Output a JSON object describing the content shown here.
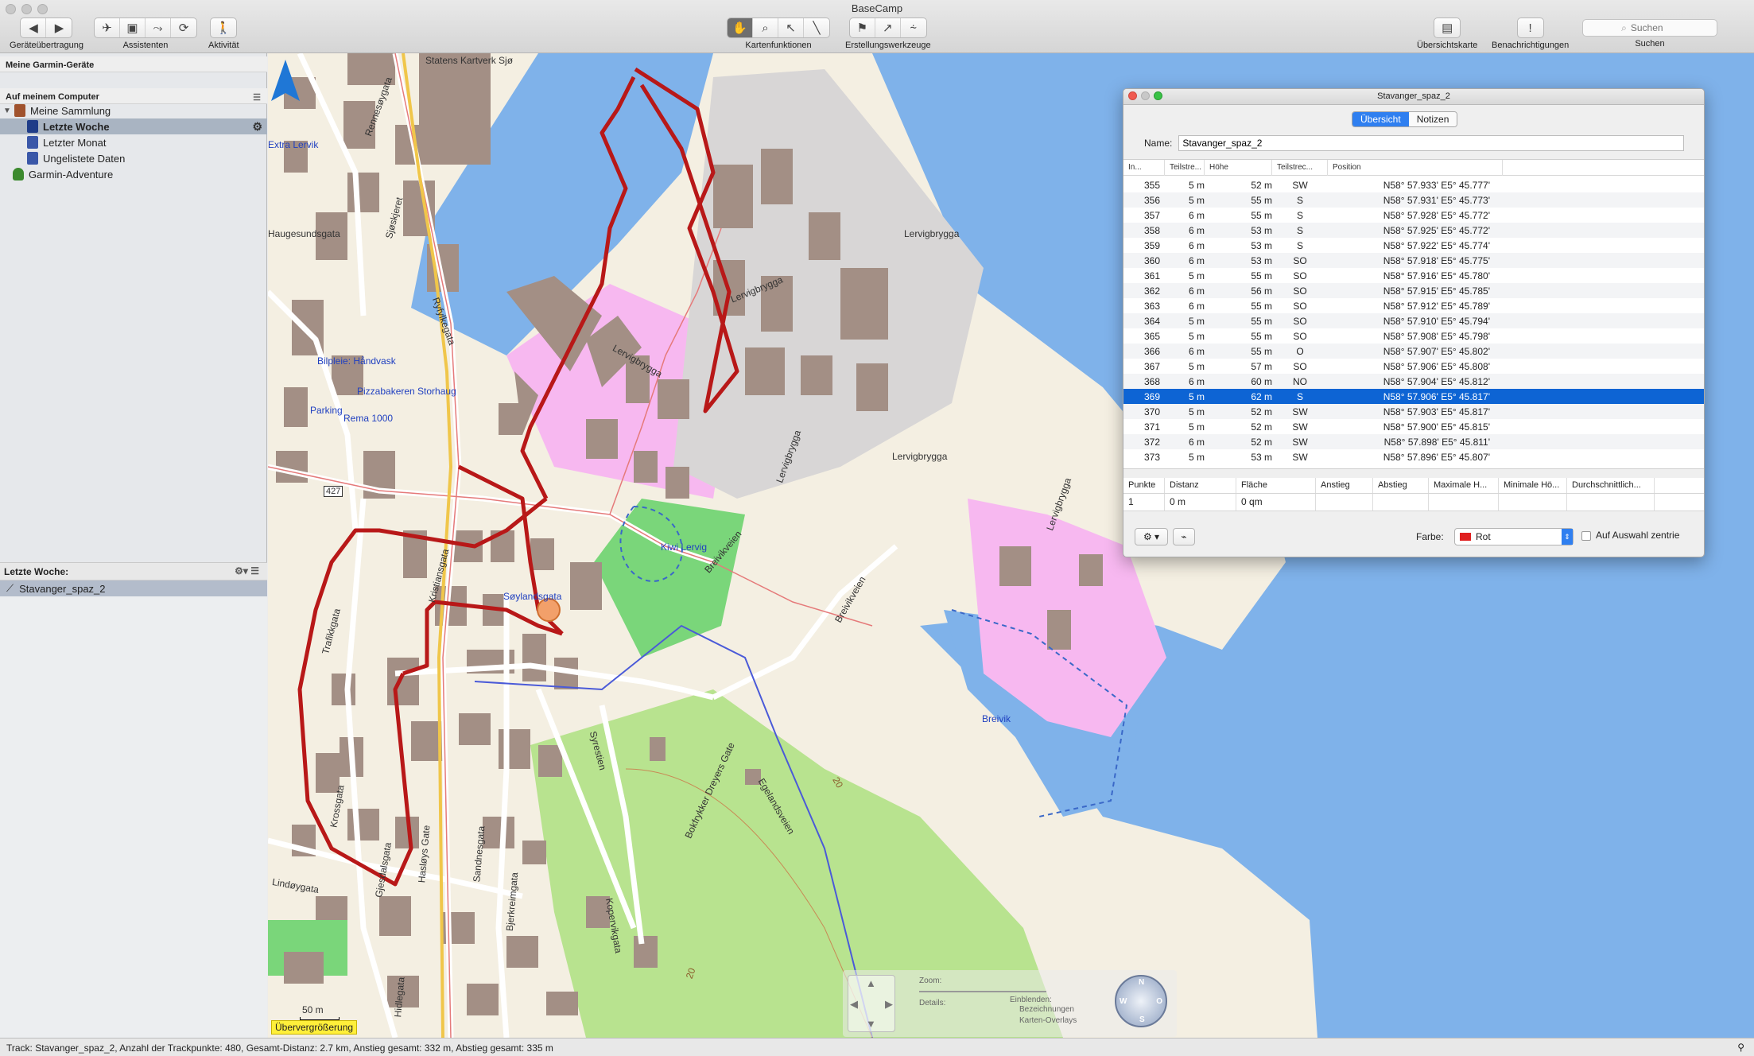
{
  "window": {
    "title": "BaseCamp"
  },
  "toolbar": {
    "groups": [
      {
        "label": "Geräteübertragung"
      },
      {
        "label": "Assistenten"
      },
      {
        "label": "Aktivität"
      },
      {
        "label": "Kartenfunktionen"
      },
      {
        "label": "Erstellungswerkzeuge"
      },
      {
        "label": "Übersichtskarte"
      },
      {
        "label": "Benachrichtigungen"
      },
      {
        "label": "Suchen"
      }
    ],
    "search_placeholder": "Suchen"
  },
  "sidebar": {
    "devices_header": "Meine Garmin-Geräte",
    "computer_header": "Auf meinem Computer",
    "items": [
      {
        "label": "Meine Sammlung"
      },
      {
        "label": "Letzte Woche"
      },
      {
        "label": "Letzter Monat"
      },
      {
        "label": "Ungelistete Daten"
      },
      {
        "label": "Garmin-Adventure"
      }
    ],
    "lower_header": "Letzte Woche:",
    "lower_items": [
      {
        "label": "Stavanger_spaz_2"
      }
    ]
  },
  "map": {
    "labels": [
      "Statens Kartverk Sjø",
      "Haugesundsgata",
      "Extra Lervik",
      "Bilpleie: Håndvask",
      "Pizzabakeren Storhaug",
      "Parking",
      "Rema 1000",
      "427",
      "Kiwi Lervig",
      "Søylandsgata",
      "Lervigbrygga",
      "Lervigbrygga",
      "Lervigbrygga",
      "Lervigbrygga",
      "Lervigbrygga",
      "Lervigbrygga",
      "Breivikveien",
      "Breivikveien",
      "Breivik",
      "Egelandsveien",
      "Bokfrykker Dreyers Gate",
      "Syrestien",
      "Sandnesgata",
      "Hasløys Gate",
      "Kopervikgata",
      "Gjesdalsgata",
      "Krossgata",
      "Lindøygata",
      "Trafikkgata",
      "Ryfylkegata",
      "Sjøskjeret",
      "Rennesøygata",
      "Hidlegata",
      "Kristiansgata",
      "Bjerkreimgata",
      "20",
      "20",
      "50 m"
    ],
    "overzoom_label": "Übervergrößerung",
    "controls": {
      "zoom_label": "Zoom:",
      "details_label": "Details:",
      "show_label": "Einblenden:",
      "check1": "Bezeichnungen",
      "check2": "Karten-Overlays",
      "compass": {
        "n": "N",
        "s": "S",
        "w": "W",
        "o": "O"
      }
    }
  },
  "panel": {
    "title": "Stavanger_spaz_2",
    "tabs": [
      {
        "label": "Übersicht"
      },
      {
        "label": "Notizen"
      }
    ],
    "name_label": "Name:",
    "name_value": "Stavanger_spaz_2",
    "columns": [
      "In...",
      "Teilstre...",
      "Höhe",
      "Teilstrec...",
      "Position"
    ],
    "rows": [
      {
        "idx": "355",
        "seg": "5 m",
        "alt": "52 m",
        "dir": "SW",
        "pos": "N58° 57.933' E5° 45.777'"
      },
      {
        "idx": "356",
        "seg": "5 m",
        "alt": "55 m",
        "dir": "S",
        "pos": "N58° 57.931' E5° 45.773'"
      },
      {
        "idx": "357",
        "seg": "6 m",
        "alt": "55 m",
        "dir": "S",
        "pos": "N58° 57.928' E5° 45.772'"
      },
      {
        "idx": "358",
        "seg": "6 m",
        "alt": "53 m",
        "dir": "S",
        "pos": "N58° 57.925' E5° 45.772'"
      },
      {
        "idx": "359",
        "seg": "6 m",
        "alt": "53 m",
        "dir": "S",
        "pos": "N58° 57.922' E5° 45.774'"
      },
      {
        "idx": "360",
        "seg": "6 m",
        "alt": "53 m",
        "dir": "SO",
        "pos": "N58° 57.918' E5° 45.775'"
      },
      {
        "idx": "361",
        "seg": "5 m",
        "alt": "55 m",
        "dir": "SO",
        "pos": "N58° 57.916' E5° 45.780'"
      },
      {
        "idx": "362",
        "seg": "6 m",
        "alt": "56 m",
        "dir": "SO",
        "pos": "N58° 57.915' E5° 45.785'"
      },
      {
        "idx": "363",
        "seg": "6 m",
        "alt": "55 m",
        "dir": "SO",
        "pos": "N58° 57.912' E5° 45.789'"
      },
      {
        "idx": "364",
        "seg": "5 m",
        "alt": "55 m",
        "dir": "SO",
        "pos": "N58° 57.910' E5° 45.794'"
      },
      {
        "idx": "365",
        "seg": "5 m",
        "alt": "55 m",
        "dir": "SO",
        "pos": "N58° 57.908' E5° 45.798'"
      },
      {
        "idx": "366",
        "seg": "6 m",
        "alt": "55 m",
        "dir": "O",
        "pos": "N58° 57.907' E5° 45.802'"
      },
      {
        "idx": "367",
        "seg": "5 m",
        "alt": "57 m",
        "dir": "SO",
        "pos": "N58° 57.906' E5° 45.808'"
      },
      {
        "idx": "368",
        "seg": "6 m",
        "alt": "60 m",
        "dir": "NO",
        "pos": "N58° 57.904' E5° 45.812'"
      },
      {
        "idx": "369",
        "seg": "5 m",
        "alt": "62 m",
        "dir": "S",
        "pos": "N58° 57.906' E5° 45.817'"
      },
      {
        "idx": "370",
        "seg": "5 m",
        "alt": "52 m",
        "dir": "SW",
        "pos": "N58° 57.903' E5° 45.817'"
      },
      {
        "idx": "371",
        "seg": "5 m",
        "alt": "52 m",
        "dir": "SW",
        "pos": "N58° 57.900' E5° 45.815'"
      },
      {
        "idx": "372",
        "seg": "6 m",
        "alt": "52 m",
        "dir": "SW",
        "pos": "N58° 57.898' E5° 45.811'"
      },
      {
        "idx": "373",
        "seg": "5 m",
        "alt": "53 m",
        "dir": "SW",
        "pos": "N58° 57.896' E5° 45.807'"
      }
    ],
    "selected_idx": "369",
    "stats_columns": [
      "Punkte",
      "Distanz",
      "Fläche",
      "Anstieg",
      "Abstieg",
      "Maximale H...",
      "Minimale Hö...",
      "Durchschnittlich..."
    ],
    "stats_values": [
      "1",
      "0 m",
      "0 qm",
      "",
      "",
      "",
      "",
      ""
    ],
    "color_label": "Farbe:",
    "color_value": "Rot",
    "color_hex": "#e02020",
    "center_label": "Auf Auswahl zentrie"
  },
  "status": {
    "text": "Track: Stavanger_spaz_2, Anzahl der Trackpunkte: 480, Gesamt-Distanz: 2.7 km, Anstieg gesamt: 332 m, Abstieg gesamt: 335 m"
  },
  "colors": {
    "water": "#7fb2ea",
    "park": "#7ad67a",
    "industrial": "#f7b8f0",
    "track": "#b81818",
    "selection": "#0d64d4"
  }
}
